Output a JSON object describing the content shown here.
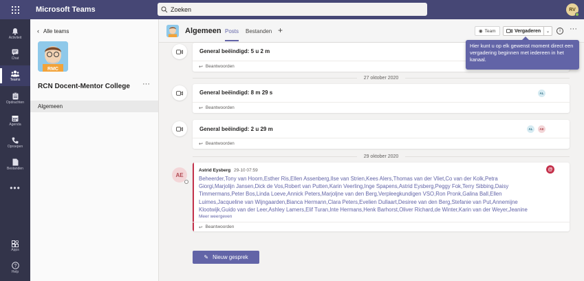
{
  "app": {
    "title": "Microsoft Teams",
    "user_initials": "RV"
  },
  "search": {
    "placeholder": "Zoeken"
  },
  "rail": [
    {
      "label": "Activiteit",
      "icon": "bell-icon"
    },
    {
      "label": "Chat",
      "icon": "chat-icon"
    },
    {
      "label": "Teams",
      "icon": "teams-icon"
    },
    {
      "label": "Opdrachten",
      "icon": "assignments-icon"
    },
    {
      "label": "Agenda",
      "icon": "calendar-icon"
    },
    {
      "label": "Oproepen",
      "icon": "phone-icon"
    },
    {
      "label": "Bestanden",
      "icon": "files-icon"
    },
    {
      "label": "",
      "icon": "more-icon"
    },
    {
      "label": "Apps",
      "icon": "apps-icon"
    },
    {
      "label": "Help",
      "icon": "help-icon"
    }
  ],
  "panel": {
    "back_label": "Alle teams",
    "team_name": "RCN Docent-Mentor College",
    "channel": "Algemeen"
  },
  "header": {
    "channel_title": "Algemeen",
    "tabs": [
      "Posts",
      "Bestanden"
    ],
    "team_button": "Team",
    "meet_button": "Vergaderen"
  },
  "tooltip": "Hier kunt u op elk gewenst moment direct een vergadering beginnen met iedereen in het kanaal.",
  "feed": {
    "meetings": [
      {
        "title": "General beëindigd: 5 u 2 m",
        "reply": "Beantwoorden",
        "participants": []
      },
      {
        "title": "General beëindigd: 8 m 29 s",
        "reply": "Beantwoorden",
        "participants": [
          "AL"
        ]
      },
      {
        "title": "General beëindigd: 2 u 29 m",
        "reply": "Beantwoorden",
        "participants": [
          "AL",
          "AE"
        ]
      }
    ],
    "dates": [
      "27 oktober 2020",
      "29 oktober 2020"
    ],
    "post": {
      "avatar": "AE",
      "author": "Astrid Eysberg",
      "time": "29-10 07:59",
      "body": "Beheerder,Tony van Hoorn,Esther Ris,Ellen Assenberg,Ilse van Strien,Kees Alers,Thomas van der Vliet,Co van der Kolk,Petra Giorgi,Marjolijn Jansen,Dick de Vos,Robert van Putten,Karin Veerling,Inge Spapens,Astrid Eysberg,Peggy Fok,Terry Sibbing,Daisy Timmermans,Peter Bos,Linda Loeve,Annick Peters,Marjoljne van den Berg,Verpleegkundigen VSO,Ron Pronk,Galina Ball,Ellen Luimes,Jacqueline van Wijngaarden,Bianca Hermann,Clara Peters,Evelien Dullaart,Desiree van den Berg,Stefanie van Put,Annemijne Klootwijk,Guido van der Leer,Ashley Lamers,Elif Turan,Inte Hermans,Henk Barhorst,Oliver Richard,de Winter,Karin van der Weyer,Jeanine van",
      "more": "Meer weergeven",
      "reply": "Beantwoorden"
    },
    "new_conversation": "Nieuw gesprek"
  }
}
